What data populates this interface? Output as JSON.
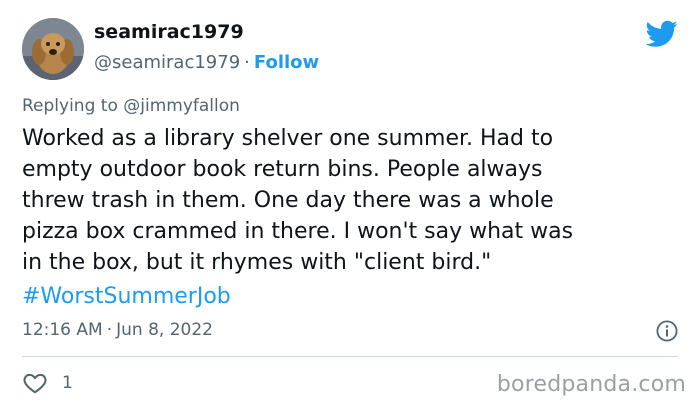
{
  "user": {
    "display_name": "seamirac1979",
    "handle": "@seamirac1979",
    "separator": "·",
    "follow_label": "Follow"
  },
  "reply": {
    "prefix": "Replying to ",
    "mention": "@jimmyfallon"
  },
  "tweet": {
    "text": "Worked as a library shelver one summer. Had to\nempty outdoor book return bins. People always\nthrew trash in them. One day there was a whole\npizza box crammed in there. I won't say what was\nin the box, but it rhymes with \"client bird.\"",
    "hashtag": "#WorstSummerJob"
  },
  "meta": {
    "time": "12:16 AM",
    "separator": "·",
    "date": "Jun 8, 2022"
  },
  "engagement": {
    "likes": "1"
  },
  "watermark": "boredpanda.com",
  "icons": {
    "brand": "twitter-bird-icon",
    "info": "info-icon",
    "like": "heart-icon"
  },
  "colors": {
    "accent": "#1d9bf0",
    "text": "#0f1419",
    "muted": "#536471",
    "divider": "#cfd9de"
  }
}
